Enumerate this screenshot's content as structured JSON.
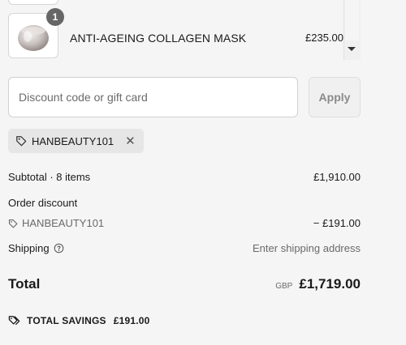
{
  "product": {
    "quantity": "1",
    "name": "ANTI-AGEING COLLAGEN MASK",
    "price": "£235.00"
  },
  "discount": {
    "placeholder": "Discount code or gift card",
    "apply_label": "Apply",
    "applied_code": "HANBEAUTY101"
  },
  "summary": {
    "subtotal_label": "Subtotal · 8 items",
    "subtotal_value": "£1,910.00",
    "order_discount_label": "Order discount",
    "discount_code": "HANBEAUTY101",
    "discount_value": "− £191.00",
    "shipping_label": "Shipping",
    "shipping_value": "Enter shipping address",
    "total_label": "Total",
    "currency": "GBP",
    "total_value": "£1,719.00",
    "savings_label": "TOTAL SAVINGS",
    "savings_value": "£191.00"
  },
  "icons": {
    "tag": "tag-icon",
    "remove": "close-icon",
    "info": "info-icon",
    "savings": "savings-tag-icon"
  }
}
